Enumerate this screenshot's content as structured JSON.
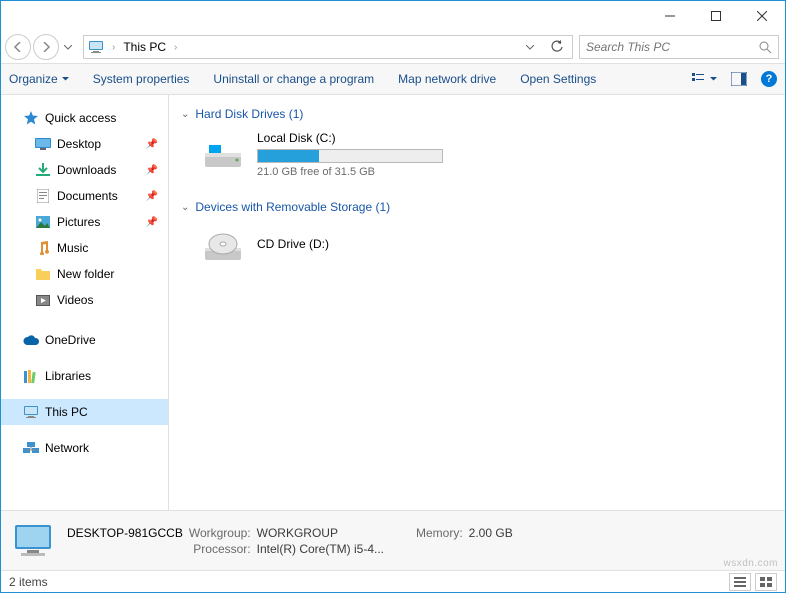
{
  "breadcrumb": {
    "location": "This PC"
  },
  "search": {
    "placeholder": "Search This PC"
  },
  "toolbar": {
    "organize": "Organize",
    "system_properties": "System properties",
    "uninstall": "Uninstall or change a program",
    "map_drive": "Map network drive",
    "open_settings": "Open Settings"
  },
  "nav": {
    "quick_access": "Quick access",
    "desktop": "Desktop",
    "downloads": "Downloads",
    "documents": "Documents",
    "pictures": "Pictures",
    "music": "Music",
    "new_folder": "New folder",
    "videos": "Videos",
    "onedrive": "OneDrive",
    "libraries": "Libraries",
    "this_pc": "This PC",
    "network": "Network"
  },
  "sections": {
    "hdd": {
      "header": "Hard Disk Drives (1)"
    },
    "removable": {
      "header": "Devices with Removable Storage (1)"
    }
  },
  "drives": {
    "local": {
      "name": "Local Disk (C:)",
      "free_text": "21.0 GB free of 31.5 GB",
      "fill_percent": 33
    },
    "cd": {
      "name": "CD Drive (D:)"
    }
  },
  "details": {
    "computer_name": "DESKTOP-981GCCB",
    "workgroup_label": "Workgroup:",
    "workgroup_value": "WORKGROUP",
    "memory_label": "Memory:",
    "memory_value": "2.00 GB",
    "processor_label": "Processor:",
    "processor_value": "Intel(R) Core(TM) i5-4..."
  },
  "status": {
    "items": "2 items"
  },
  "watermark": "wsxdn.com"
}
